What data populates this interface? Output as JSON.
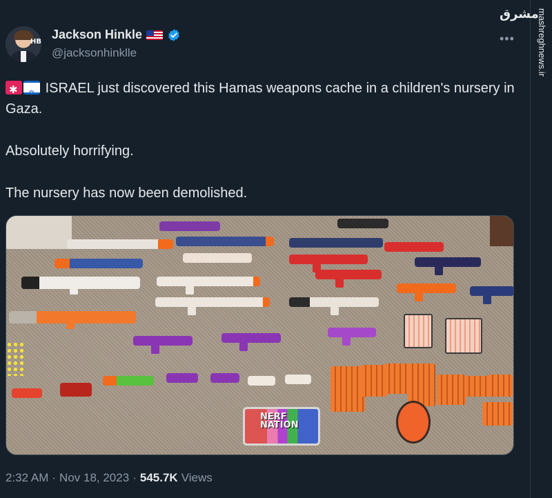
{
  "author": {
    "display_name": "Jackson Hinkle",
    "handle": "@jacksonhinklle",
    "flag_icon": "us-flag-emoji",
    "verified_icon": "verified-badge-icon",
    "avatar_monogram": "HB"
  },
  "more_icon": "more-options-icon",
  "watermark": {
    "logo": "مشرق",
    "site": "mashreghnews.ir"
  },
  "tweet": {
    "lead_icons": [
      "siren-emoji",
      "israel-flag-emoji"
    ],
    "line1": "ISRAEL just discovered this Hamas weapons cache in a children's nursery in Gaza.",
    "line2": "Absolutely horrifying.",
    "line3": "The nursery has now been demolished."
  },
  "photo": {
    "box_label": "NERF NATION"
  },
  "meta": {
    "time": "2:32 AM",
    "separator1": "·",
    "date": "Nov 18, 2023",
    "separator2": "·",
    "views_count": "545.7K",
    "views_label": "Views"
  },
  "colors": {
    "background": "#15202b",
    "text": "#e7e9ea",
    "secondary": "#8b98a5",
    "verified": "#1d9bf0"
  }
}
